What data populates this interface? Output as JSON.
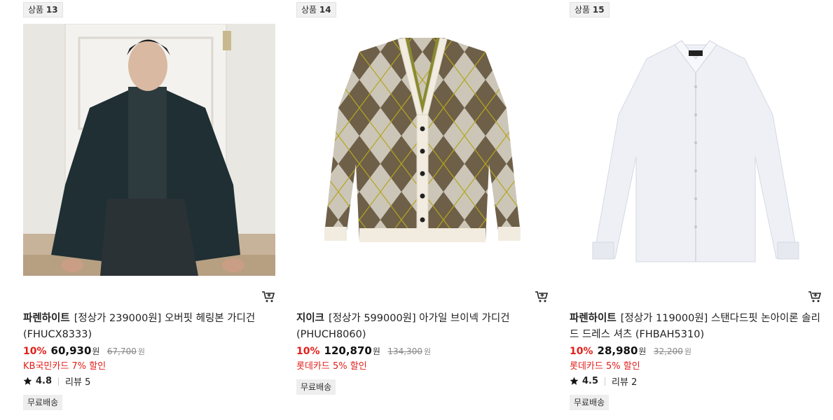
{
  "products": [
    {
      "badge_prefix": "상품",
      "badge_num": "13",
      "brand": "파렌하이트",
      "title": "[정상가 239000원] 오버핏 헤링본 가디건 (FHUCX8333)",
      "discount_rate": "10%",
      "price": "60,930",
      "won": "원",
      "original_price": "67,700",
      "promo": "KB국민카드 7% 할인",
      "rating": "4.8",
      "review_label": "리뷰 5",
      "shipping": "무료배송"
    },
    {
      "badge_prefix": "상품",
      "badge_num": "14",
      "brand": "지이크",
      "title": "[정상가 599000원] 아가일 브이넥 가디건 (PHUCH8060)",
      "discount_rate": "10%",
      "price": "120,870",
      "won": "원",
      "original_price": "134,300",
      "promo": "롯데카드 5% 할인",
      "shipping": "무료배송"
    },
    {
      "badge_prefix": "상품",
      "badge_num": "15",
      "brand": "파렌하이트",
      "title": "[정상가 119000원] 스탠다드핏 논아이론 솔리드 드레스 셔츠 (FHBAH5310)",
      "discount_rate": "10%",
      "price": "28,980",
      "won": "원",
      "original_price": "32,200",
      "promo": "롯데카드 5% 할인",
      "rating": "4.5",
      "review_label": "리뷰 2",
      "shipping": "무료배송"
    }
  ],
  "colors": {
    "accent": "#e0201c"
  },
  "icons": {
    "cart": "cart-icon",
    "rating": "star-icon"
  }
}
